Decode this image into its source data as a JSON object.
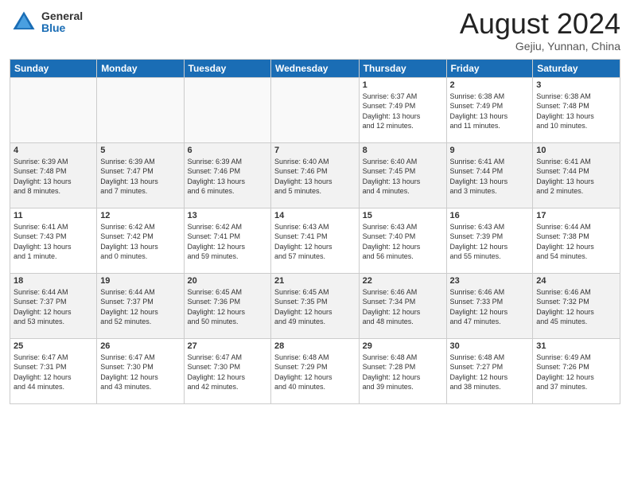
{
  "header": {
    "logo_general": "General",
    "logo_blue": "Blue",
    "month_title": "August 2024",
    "location": "Gejiu, Yunnan, China"
  },
  "days_of_week": [
    "Sunday",
    "Monday",
    "Tuesday",
    "Wednesday",
    "Thursday",
    "Friday",
    "Saturday"
  ],
  "weeks": [
    [
      {
        "day": "",
        "info": ""
      },
      {
        "day": "",
        "info": ""
      },
      {
        "day": "",
        "info": ""
      },
      {
        "day": "",
        "info": ""
      },
      {
        "day": "1",
        "info": "Sunrise: 6:37 AM\nSunset: 7:49 PM\nDaylight: 13 hours\nand 12 minutes."
      },
      {
        "day": "2",
        "info": "Sunrise: 6:38 AM\nSunset: 7:49 PM\nDaylight: 13 hours\nand 11 minutes."
      },
      {
        "day": "3",
        "info": "Sunrise: 6:38 AM\nSunset: 7:48 PM\nDaylight: 13 hours\nand 10 minutes."
      }
    ],
    [
      {
        "day": "4",
        "info": "Sunrise: 6:39 AM\nSunset: 7:48 PM\nDaylight: 13 hours\nand 8 minutes."
      },
      {
        "day": "5",
        "info": "Sunrise: 6:39 AM\nSunset: 7:47 PM\nDaylight: 13 hours\nand 7 minutes."
      },
      {
        "day": "6",
        "info": "Sunrise: 6:39 AM\nSunset: 7:46 PM\nDaylight: 13 hours\nand 6 minutes."
      },
      {
        "day": "7",
        "info": "Sunrise: 6:40 AM\nSunset: 7:46 PM\nDaylight: 13 hours\nand 5 minutes."
      },
      {
        "day": "8",
        "info": "Sunrise: 6:40 AM\nSunset: 7:45 PM\nDaylight: 13 hours\nand 4 minutes."
      },
      {
        "day": "9",
        "info": "Sunrise: 6:41 AM\nSunset: 7:44 PM\nDaylight: 13 hours\nand 3 minutes."
      },
      {
        "day": "10",
        "info": "Sunrise: 6:41 AM\nSunset: 7:44 PM\nDaylight: 13 hours\nand 2 minutes."
      }
    ],
    [
      {
        "day": "11",
        "info": "Sunrise: 6:41 AM\nSunset: 7:43 PM\nDaylight: 13 hours\nand 1 minute."
      },
      {
        "day": "12",
        "info": "Sunrise: 6:42 AM\nSunset: 7:42 PM\nDaylight: 13 hours\nand 0 minutes."
      },
      {
        "day": "13",
        "info": "Sunrise: 6:42 AM\nSunset: 7:41 PM\nDaylight: 12 hours\nand 59 minutes."
      },
      {
        "day": "14",
        "info": "Sunrise: 6:43 AM\nSunset: 7:41 PM\nDaylight: 12 hours\nand 57 minutes."
      },
      {
        "day": "15",
        "info": "Sunrise: 6:43 AM\nSunset: 7:40 PM\nDaylight: 12 hours\nand 56 minutes."
      },
      {
        "day": "16",
        "info": "Sunrise: 6:43 AM\nSunset: 7:39 PM\nDaylight: 12 hours\nand 55 minutes."
      },
      {
        "day": "17",
        "info": "Sunrise: 6:44 AM\nSunset: 7:38 PM\nDaylight: 12 hours\nand 54 minutes."
      }
    ],
    [
      {
        "day": "18",
        "info": "Sunrise: 6:44 AM\nSunset: 7:37 PM\nDaylight: 12 hours\nand 53 minutes."
      },
      {
        "day": "19",
        "info": "Sunrise: 6:44 AM\nSunset: 7:37 PM\nDaylight: 12 hours\nand 52 minutes."
      },
      {
        "day": "20",
        "info": "Sunrise: 6:45 AM\nSunset: 7:36 PM\nDaylight: 12 hours\nand 50 minutes."
      },
      {
        "day": "21",
        "info": "Sunrise: 6:45 AM\nSunset: 7:35 PM\nDaylight: 12 hours\nand 49 minutes."
      },
      {
        "day": "22",
        "info": "Sunrise: 6:46 AM\nSunset: 7:34 PM\nDaylight: 12 hours\nand 48 minutes."
      },
      {
        "day": "23",
        "info": "Sunrise: 6:46 AM\nSunset: 7:33 PM\nDaylight: 12 hours\nand 47 minutes."
      },
      {
        "day": "24",
        "info": "Sunrise: 6:46 AM\nSunset: 7:32 PM\nDaylight: 12 hours\nand 45 minutes."
      }
    ],
    [
      {
        "day": "25",
        "info": "Sunrise: 6:47 AM\nSunset: 7:31 PM\nDaylight: 12 hours\nand 44 minutes."
      },
      {
        "day": "26",
        "info": "Sunrise: 6:47 AM\nSunset: 7:30 PM\nDaylight: 12 hours\nand 43 minutes."
      },
      {
        "day": "27",
        "info": "Sunrise: 6:47 AM\nSunset: 7:30 PM\nDaylight: 12 hours\nand 42 minutes."
      },
      {
        "day": "28",
        "info": "Sunrise: 6:48 AM\nSunset: 7:29 PM\nDaylight: 12 hours\nand 40 minutes."
      },
      {
        "day": "29",
        "info": "Sunrise: 6:48 AM\nSunset: 7:28 PM\nDaylight: 12 hours\nand 39 minutes."
      },
      {
        "day": "30",
        "info": "Sunrise: 6:48 AM\nSunset: 7:27 PM\nDaylight: 12 hours\nand 38 minutes."
      },
      {
        "day": "31",
        "info": "Sunrise: 6:49 AM\nSunset: 7:26 PM\nDaylight: 12 hours\nand 37 minutes."
      }
    ]
  ]
}
